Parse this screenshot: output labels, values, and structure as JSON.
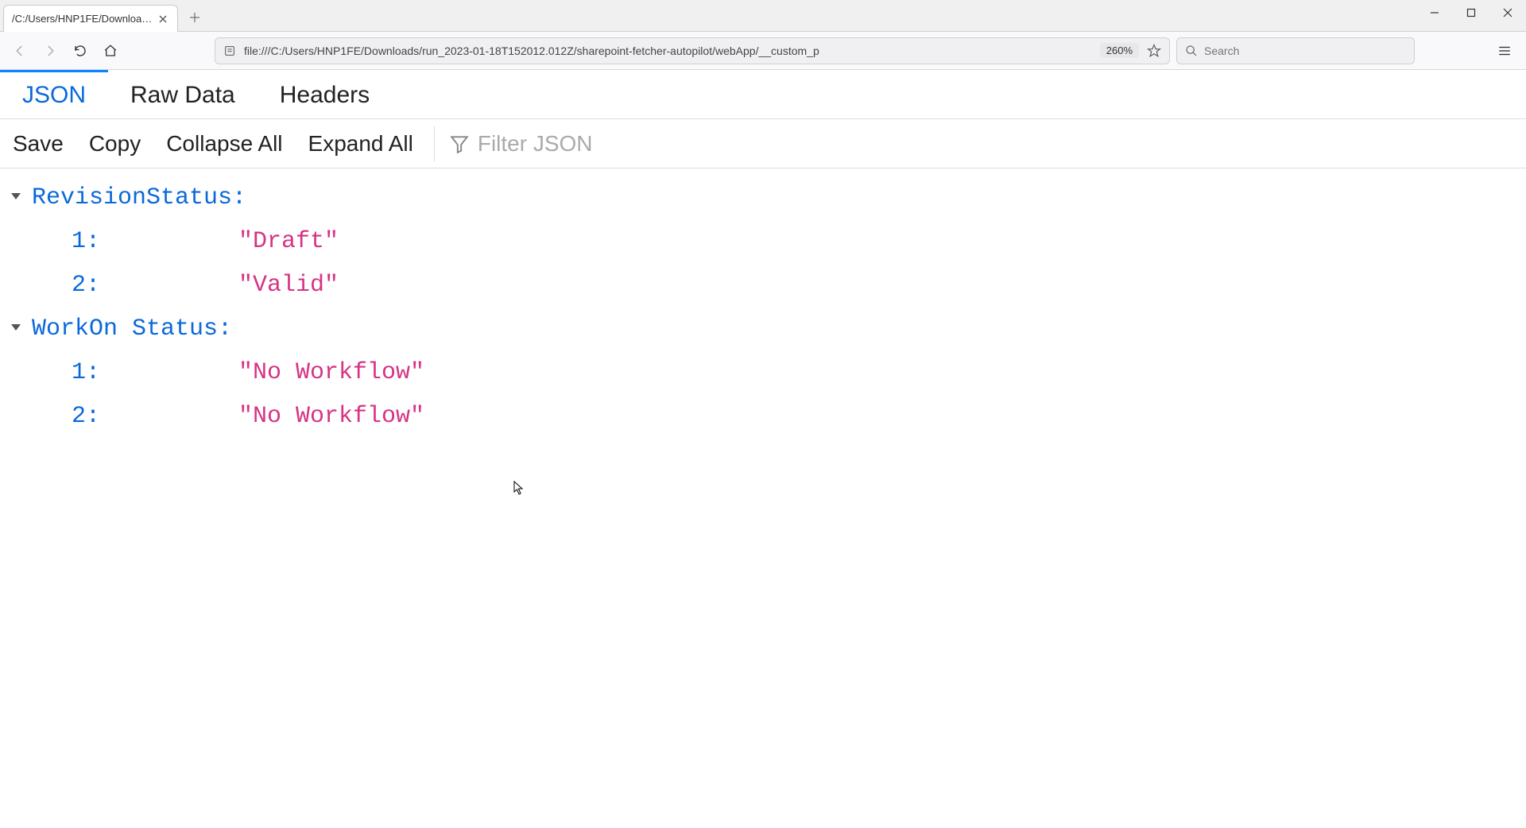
{
  "browser_tab": {
    "title": "/C:/Users/HNP1FE/Downloads/run_..."
  },
  "nav": {
    "url": "file:///C:/Users/HNP1FE/Downloads/run_2023-01-18T152012.012Z/sharepoint-fetcher-autopilot/webApp/__custom_p",
    "zoom": "260%",
    "search_placeholder": "Search"
  },
  "viewer": {
    "tabs": {
      "json": "JSON",
      "raw": "Raw Data",
      "headers": "Headers",
      "active": "json"
    },
    "toolbar": {
      "save": "Save",
      "copy": "Copy",
      "collapse_all": "Collapse All",
      "expand_all": "Expand All",
      "filter_placeholder": "Filter JSON"
    }
  },
  "json_data": {
    "nodes": [
      {
        "key": "RevisionStatus:",
        "children": [
          {
            "key": "1:",
            "value": "\"Draft\""
          },
          {
            "key": "2:",
            "value": "\"Valid\""
          }
        ]
      },
      {
        "key": "WorkOn Status:",
        "children": [
          {
            "key": "1:",
            "value": "\"No Workflow\""
          },
          {
            "key": "2:",
            "value": "\"No Workflow\""
          }
        ]
      }
    ]
  }
}
